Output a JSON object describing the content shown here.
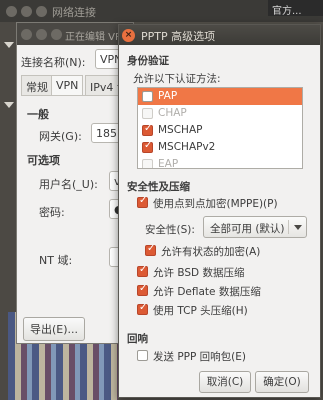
{
  "background_window": {
    "title": "网络连接",
    "topbar_right": "官方...",
    "export_label": "导出(E)..."
  },
  "editor_window": {
    "title": "正在编辑 VPN",
    "connection_name_label": "连接名称(N):",
    "connection_name_value": "VPN",
    "tabs": [
      "常规",
      "VPN",
      "IPv4 设"
    ],
    "general_heading": "一般",
    "gateway_label": "网关(G):",
    "gateway_value": "185.",
    "optional_heading": "可选项",
    "username_label": "用户名(_U):",
    "username_value": "vp",
    "password_label": "密码:",
    "nt_domain_label": "NT 域:"
  },
  "dialog": {
    "title": "PPTP 高级选项",
    "close_icon": "close-icon",
    "auth": {
      "heading": "身份验证",
      "allow_label": "允许以下认证方法:",
      "methods": [
        {
          "name": "PAP",
          "checked": false,
          "selected": true,
          "dim": false
        },
        {
          "name": "CHAP",
          "checked": false,
          "selected": false,
          "dim": true
        },
        {
          "name": "MSCHAP",
          "checked": true,
          "selected": false,
          "dim": false
        },
        {
          "name": "MSCHAPv2",
          "checked": true,
          "selected": false,
          "dim": false
        },
        {
          "name": "EAP",
          "checked": false,
          "selected": false,
          "dim": true
        }
      ]
    },
    "security": {
      "heading": "安全性及压缩",
      "mppe_label": "使用点到点加密(MPPE)(P)",
      "security_label": "安全性(S):",
      "security_value": "全部可用 (默认)",
      "stateful_label": "允许有状态的加密(A)",
      "bsd_label": "允许 BSD 数据压缩",
      "deflate_label": "允许 Deflate 数据压缩",
      "tcp_label": "使用 TCP 头压缩(H)"
    },
    "echo": {
      "heading": "回响",
      "ppp_echo_label": "发送 PPP 回响包(E)"
    },
    "buttons": {
      "cancel": "取消(C)",
      "ok": "确定(O)"
    }
  }
}
